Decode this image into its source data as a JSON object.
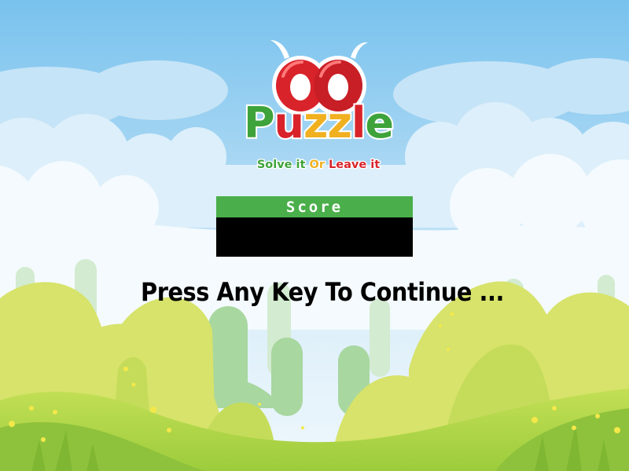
{
  "logo": {
    "word_letters": [
      {
        "char": "P",
        "color": "#3ea33a"
      },
      {
        "char": "u",
        "color": "#d9232b"
      },
      {
        "char": "z",
        "color": "#f0b020"
      },
      {
        "char": "z",
        "color": "#f0b020"
      },
      {
        "char": "l",
        "color": "#d9232b"
      },
      {
        "char": "e",
        "color": "#3ea33a"
      }
    ],
    "tagline": [
      {
        "text": "Solve it ",
        "color": "#3ea33a"
      },
      {
        "text": "Or ",
        "color": "#f0b020"
      },
      {
        "text": "Leave it",
        "color": "#d9232b"
      }
    ]
  },
  "score": {
    "label": "Score",
    "value": ""
  },
  "prompt": "Press Any Key To Continue ...",
  "colors": {
    "sky_top": "#7cc4ee",
    "sky_bottom": "#cfe8f8",
    "cloud": "#ffffff",
    "hill_light": "#d9e46a",
    "hill_mid": "#b9d84a",
    "grass_dark": "#8cc63f",
    "score_green": "#4aaf4a",
    "logo_red": "#d9232b"
  }
}
